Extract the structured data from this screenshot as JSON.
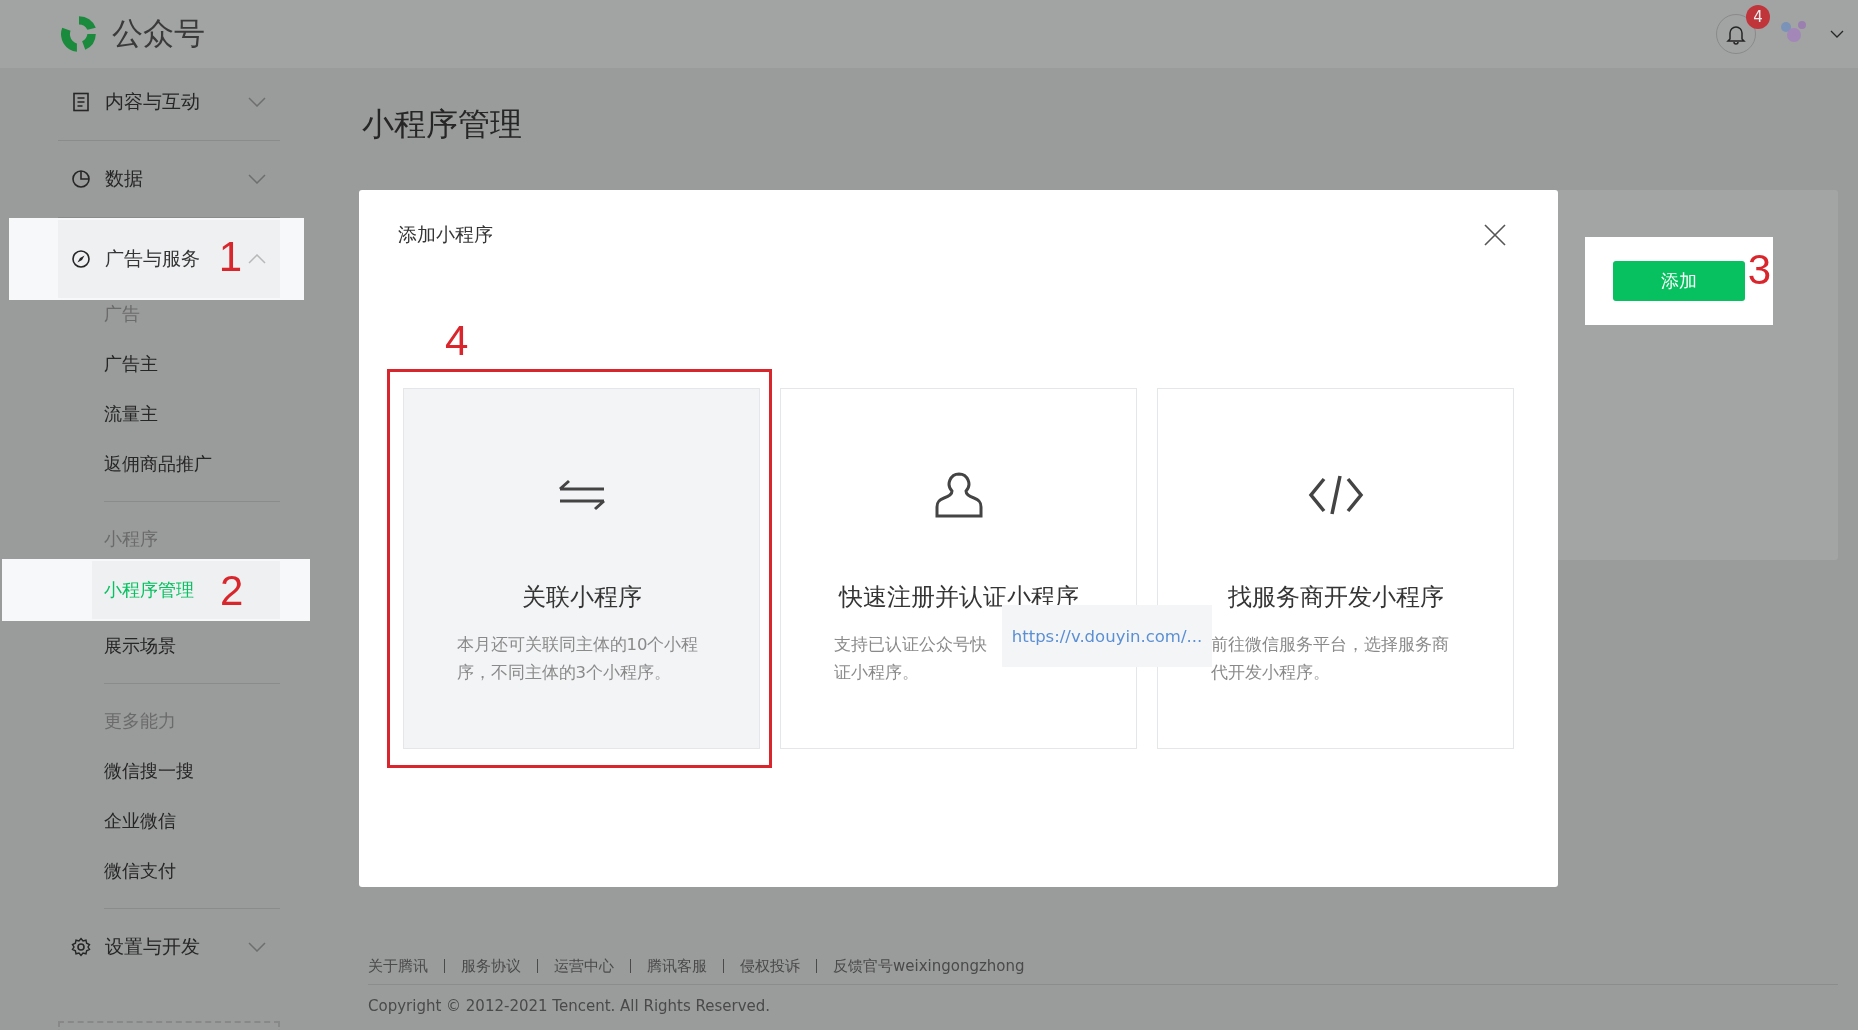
{
  "header": {
    "logo_text": "公众号",
    "notification_count": "4"
  },
  "sidebar": [
    {
      "label": "内容与互动",
      "expanded": false
    },
    {
      "label": "数据",
      "expanded": false
    },
    {
      "label": "广告与服务",
      "expanded": true,
      "step": "1",
      "sections": [
        {
          "title": "广告",
          "items": [
            {
              "label": "广告主",
              "selected": false
            },
            {
              "label": "流量主",
              "selected": false
            },
            {
              "label": "返佣商品推广",
              "selected": false
            }
          ]
        },
        {
          "title": "小程序",
          "items": [
            {
              "label": "小程序管理",
              "selected": true,
              "step": "2"
            },
            {
              "label": "展示场景",
              "selected": false
            }
          ]
        },
        {
          "title": "更多能力",
          "items": [
            {
              "label": "微信搜一搜",
              "selected": false
            },
            {
              "label": "企业微信",
              "selected": false
            },
            {
              "label": "微信支付",
              "selected": false
            }
          ]
        }
      ]
    },
    {
      "label": "设置与开发",
      "expanded": false
    }
  ],
  "page": {
    "title": "小程序管理",
    "add_button": "添加",
    "add_step": "3"
  },
  "dialog": {
    "title": "添加小程序",
    "step": "4",
    "cards": [
      {
        "title": "关联小程序",
        "lines": [
          "本月还可关联同主体的10个小程",
          "序，不同主体的3个小程序。"
        ],
        "selected": true
      },
      {
        "title": "快速注册并认证小程序",
        "lines": [
          "支持已认证公众号快",
          "证小程序。"
        ],
        "selected": false
      },
      {
        "title": "找服务商开发小程序",
        "lines": [
          "前往微信服务平台，选择服务商",
          "代开发小程序。"
        ],
        "selected": false
      }
    ],
    "tooltip": "https://v.douyin.com/..."
  },
  "footer": {
    "links": [
      "关于腾讯",
      "服务协议",
      "运营中心",
      "腾讯客服",
      "侵权投诉",
      "反馈官号weixingongzhong"
    ],
    "copyright": "Copyright © 2012-2021 Tencent. All Rights Reserved."
  }
}
